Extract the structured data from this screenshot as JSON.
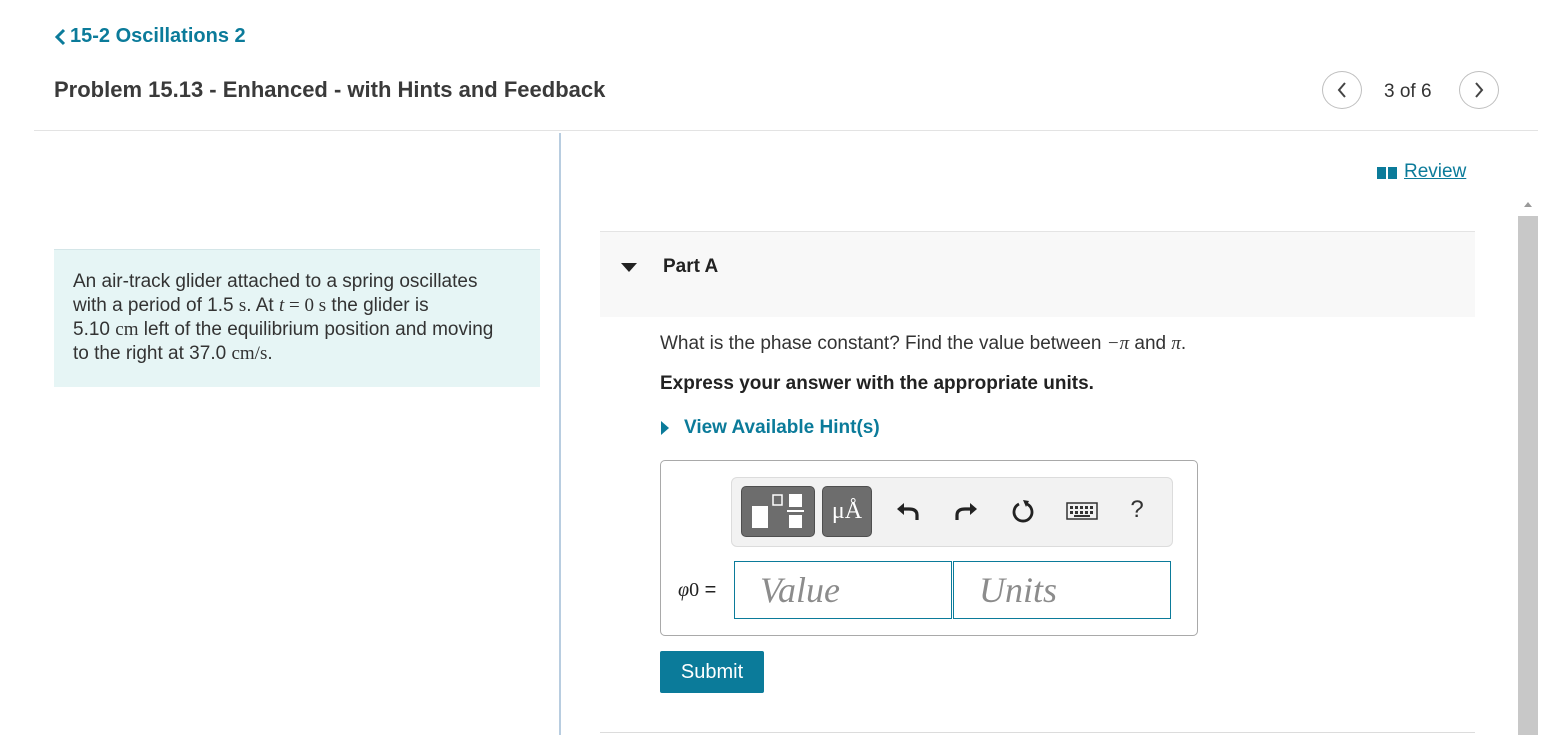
{
  "header": {
    "back_label": "15-2 Oscillations 2",
    "problem_title": "Problem 15.13 - Enhanced - with Hints and Feedback",
    "page_count": "3 of 6"
  },
  "statement": {
    "line1": "An air-track glider attached to a spring oscillates",
    "line2_a": "with a period of 1.5",
    "line2_unit": "s",
    "line2_b": ". At",
    "line2_var": "t",
    "line2_eq": "= 0",
    "line2_unit2": "s",
    "line2_c": "the glider is",
    "line3_num": "5.10",
    "line3_unit": "cm",
    "line3_b": "left of the equilibrium position and moving",
    "line4_a": "to the right at 37.0",
    "line4_unit": "cm/s",
    "line4_end": "."
  },
  "review": {
    "label": "Review"
  },
  "part": {
    "label": "Part A",
    "question_a": "What is the phase constant? Find the value between",
    "question_sym1": "−π",
    "question_and": "and",
    "question_sym2": "π",
    "question_end": ".",
    "instruction": "Express your answer with the appropriate units.",
    "hints_label": "View Available Hint(s)"
  },
  "answer": {
    "toolbar": {
      "symbols_label": "μÅ",
      "help_label": "?"
    },
    "variable": "φ",
    "variable_sub": "0",
    "equals": "=",
    "value_placeholder": "Value",
    "units_placeholder": "Units"
  },
  "submit_label": "Submit",
  "colors": {
    "accent": "#0b7b9a",
    "statement_bg": "#e6f5f5",
    "part_bg": "#f8f8f8",
    "toolbar_button": "#6d6d6d"
  },
  "icons": {
    "back": "chevron-left-icon",
    "prev": "chevron-left-icon",
    "next": "chevron-right-icon",
    "review": "book-icon",
    "part_toggle": "caret-down-icon",
    "hints": "caret-right-icon",
    "templates": "fraction-template-icon",
    "undo": "undo-icon",
    "redo": "redo-icon",
    "reset": "reset-icon",
    "keyboard": "keyboard-icon"
  }
}
